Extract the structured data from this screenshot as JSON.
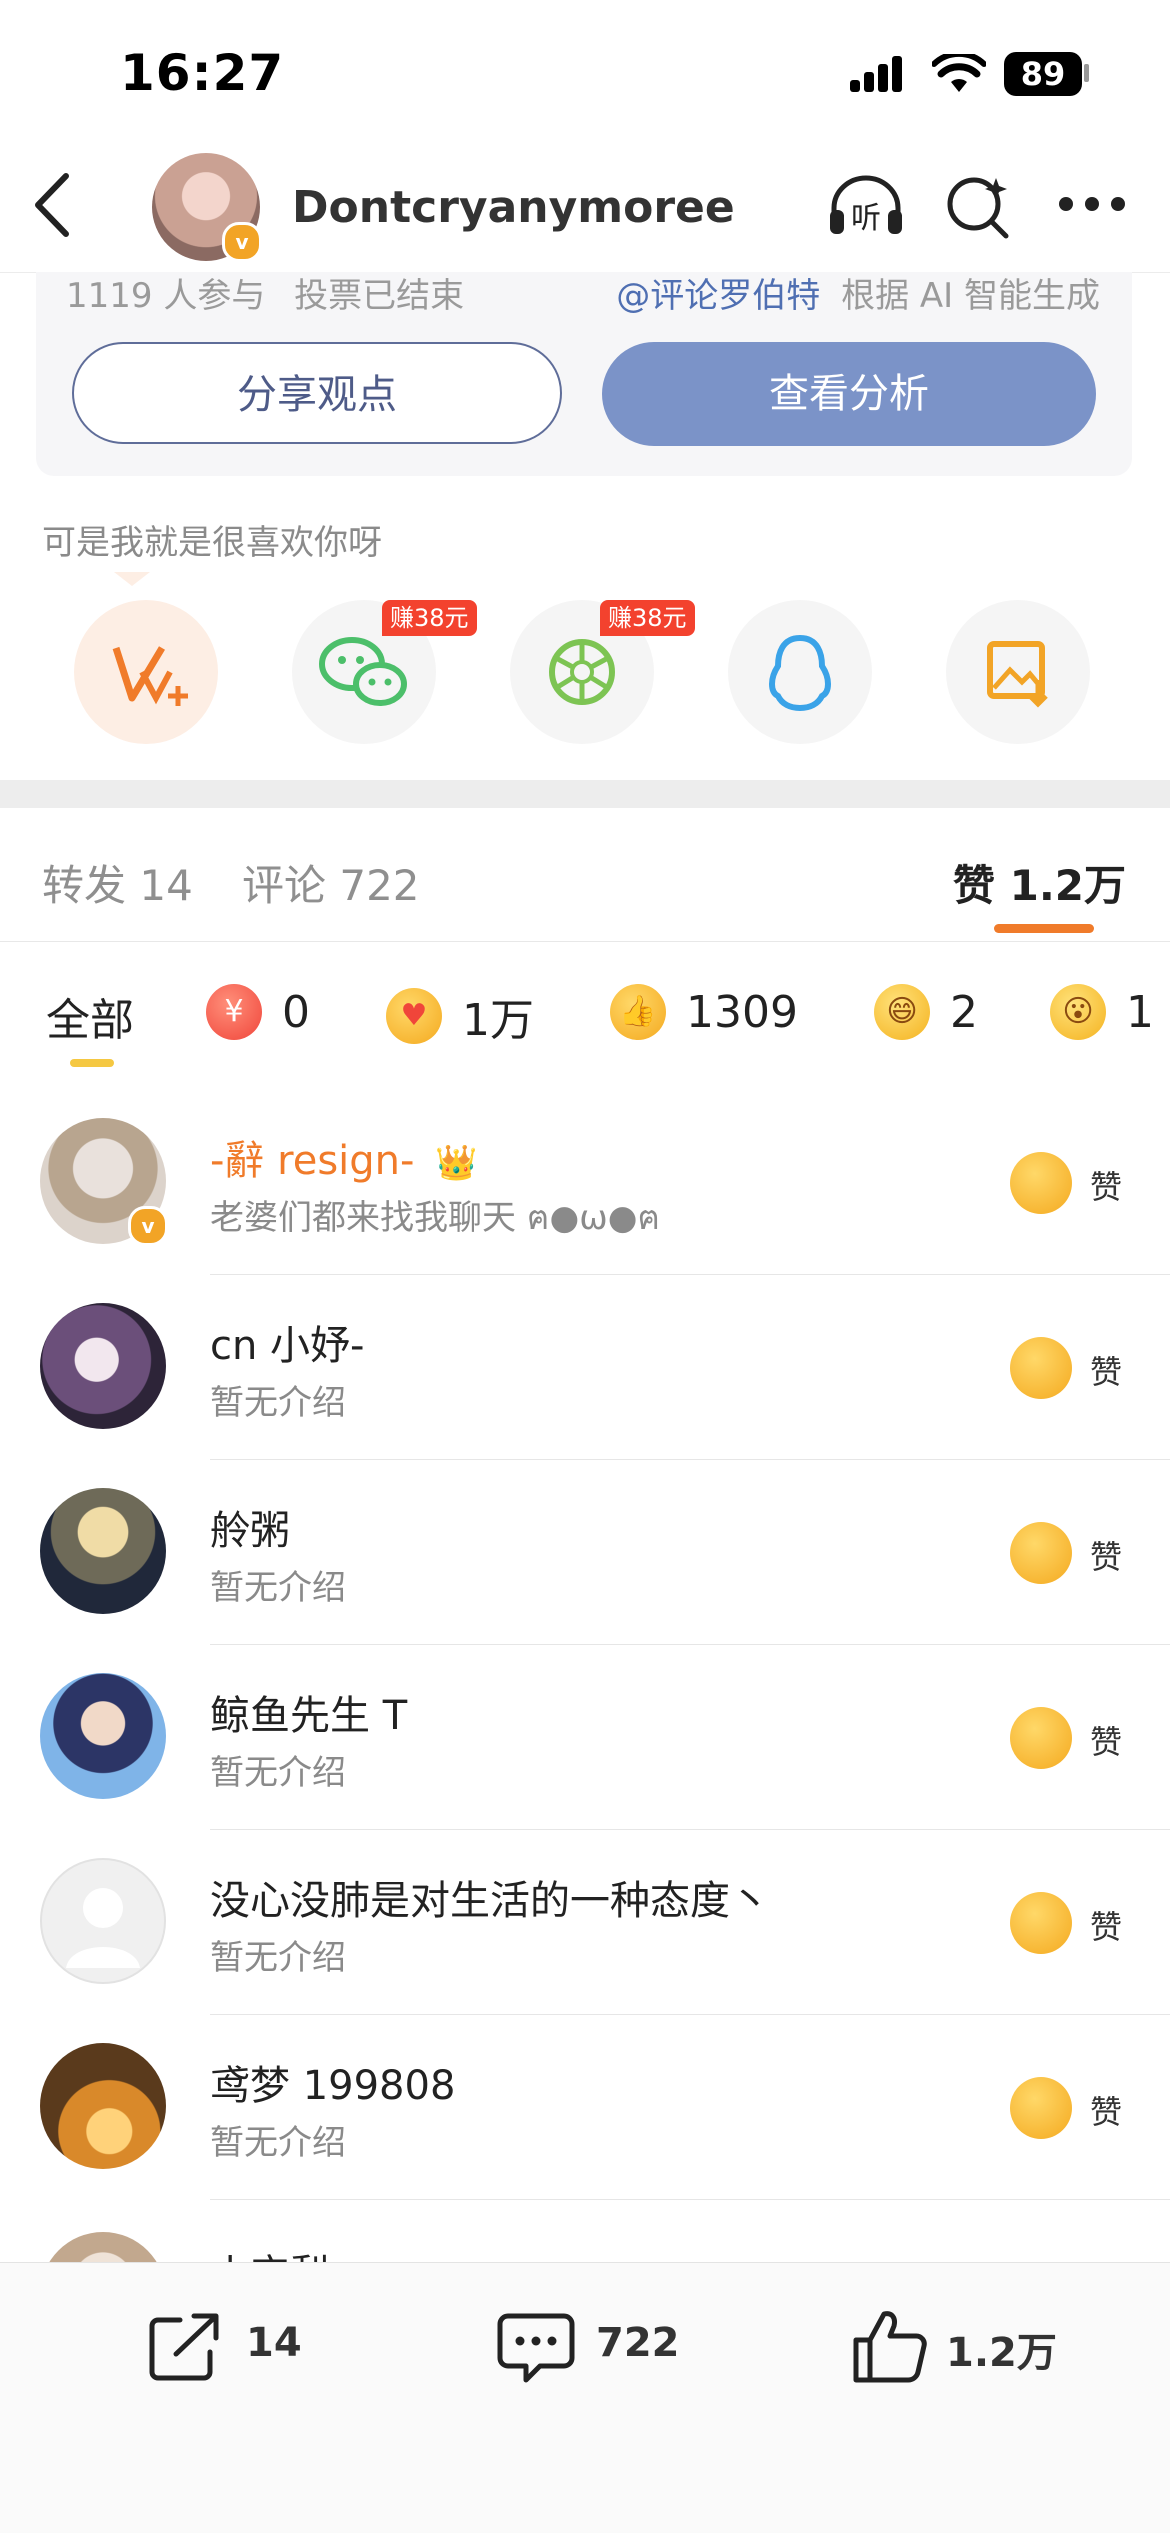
{
  "status": {
    "time": "16:27",
    "battery": "89"
  },
  "nav": {
    "username": "Dontcryanymoree",
    "listen_label": "听"
  },
  "poll": {
    "participants": "1119 人参与",
    "status": "投票已结束",
    "ai_link": "@评论罗伯特",
    "ai_text": "根据 AI 智能生成",
    "share_label": "分享观点",
    "analysis_label": "查看分析"
  },
  "post_text": "可是我就是很喜欢你呀",
  "share_row": {
    "earn_tag_1": "赚38元",
    "earn_tag_2": "赚38元"
  },
  "tabs": {
    "repost": "转发 14",
    "comment": "评论 722",
    "like": "赞 1.2万"
  },
  "reactions": [
    {
      "label": "全部"
    },
    {
      "count": "0"
    },
    {
      "count": "1万"
    },
    {
      "count": "1309"
    },
    {
      "count": "2"
    },
    {
      "count": "1"
    }
  ],
  "colors": {
    "accent_orange": "#f07b2a",
    "primary_blue": "#7b93c8",
    "earn_red": "#f3422e"
  },
  "likers": [
    {
      "name": "-辭 resign-",
      "bio": "老婆们都来找我聊天 ฅ●ω●ฅ",
      "action": "赞"
    },
    {
      "name": "cn 小妤-",
      "bio": "暂无介绍",
      "action": "赞"
    },
    {
      "name": "舲粥",
      "bio": "暂无介绍",
      "action": "赞"
    },
    {
      "name": "鲸鱼先生 T",
      "bio": "暂无介绍",
      "action": "赞"
    },
    {
      "name": "没心没肺是对生活的一种态度丶",
      "bio": "暂无介绍",
      "action": "赞"
    },
    {
      "name": "鸢梦 199808",
      "bio": "暂无介绍",
      "action": "赞"
    },
    {
      "name": "小宝梨",
      "bio": "",
      "action": ""
    }
  ],
  "bottom_bar": {
    "repost_count": "14",
    "comment_count": "722",
    "like_count": "1.2万"
  }
}
